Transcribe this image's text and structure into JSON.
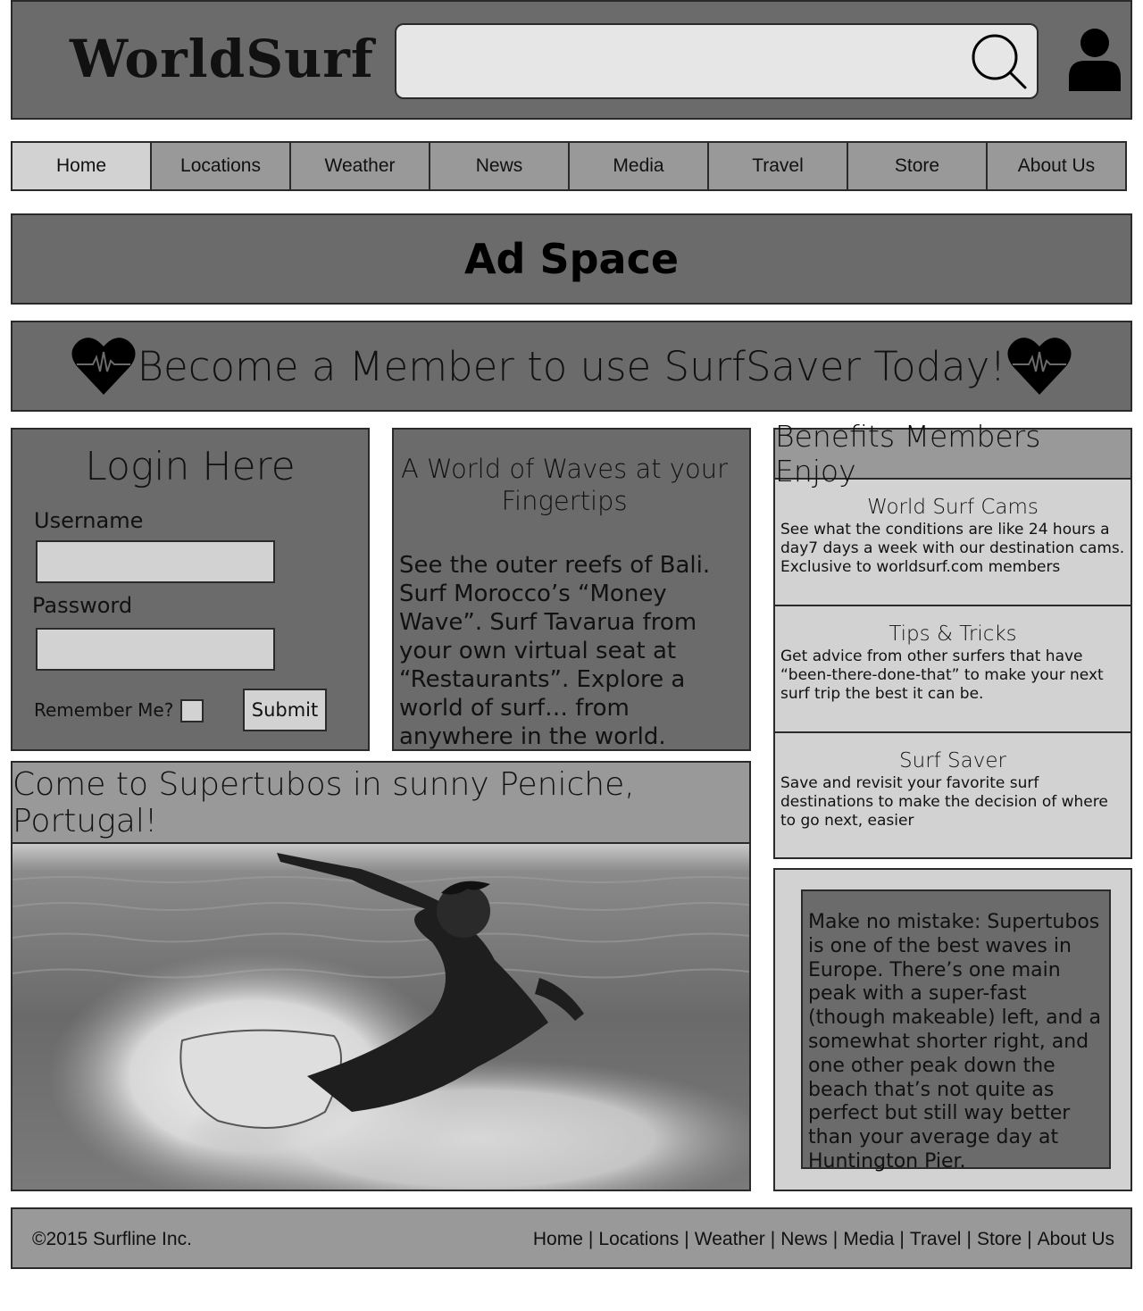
{
  "header": {
    "logo": "WorldSurf",
    "search": {
      "value": "",
      "placeholder": ""
    }
  },
  "nav": {
    "items": [
      {
        "label": "Home",
        "active": true
      },
      {
        "label": "Locations"
      },
      {
        "label": "Weather"
      },
      {
        "label": "News"
      },
      {
        "label": "Media"
      },
      {
        "label": "Travel"
      },
      {
        "label": "Store"
      },
      {
        "label": "About Us"
      }
    ]
  },
  "ad": {
    "label": "Ad Space"
  },
  "banner": {
    "text": "Become a Member to use SurfSaver Today!"
  },
  "login": {
    "title": "Login Here",
    "username_label": "Username",
    "password_label": "Password",
    "remember_label": "Remember Me?",
    "submit_label": "Submit"
  },
  "waves": {
    "title": "A World of Waves at your Fingertips",
    "body": "See the outer reefs of Bali. Surf Morocco’s “Money Wave”. Surf Tavarua from your own virtual seat at “Restaurants”. Explore a world of surf… from anywhere in the world."
  },
  "benefits": {
    "title": "Benefits Members Enjoy",
    "items": [
      {
        "title": "World Surf Cams",
        "desc": "See what the conditions are like 24 hours a day7 days a week with our destination cams. Exclusive to worldsurf.com members"
      },
      {
        "title": "Tips & Tricks",
        "desc": "Get advice from other surfers that have “been-there-done-that” to make your next surf trip the best it can be."
      },
      {
        "title": "Surf Saver",
        "desc": "Save and revisit your favorite surf destinations to make the decision of where to go next, easier"
      }
    ]
  },
  "feature": {
    "title": "Come to Supertubos in sunny Peniche, Portugal!"
  },
  "description": {
    "text": "Make no mistake: Supertubos is one of the best waves in Europe. There’s one main peak with a super-fast (though makeable) left, and a somewhat shorter right, and one other peak down the beach that’s not quite as perfect but still way better than your average day at Huntington Pier."
  },
  "footer": {
    "copyright": "©2015 Surfline Inc.",
    "links": [
      "Home",
      "Locations",
      "Weather",
      "News",
      "Media",
      "Travel",
      "Store",
      "About Us"
    ]
  },
  "colors": {
    "dark_panel": "#6b6b6b",
    "mid_panel": "#999999",
    "light_panel": "#d2d2d2",
    "input_fill": "#e6e6e6",
    "border": "#2a2a2a"
  },
  "icons": [
    "search-icon",
    "user-icon",
    "heart-pulse-icon"
  ]
}
